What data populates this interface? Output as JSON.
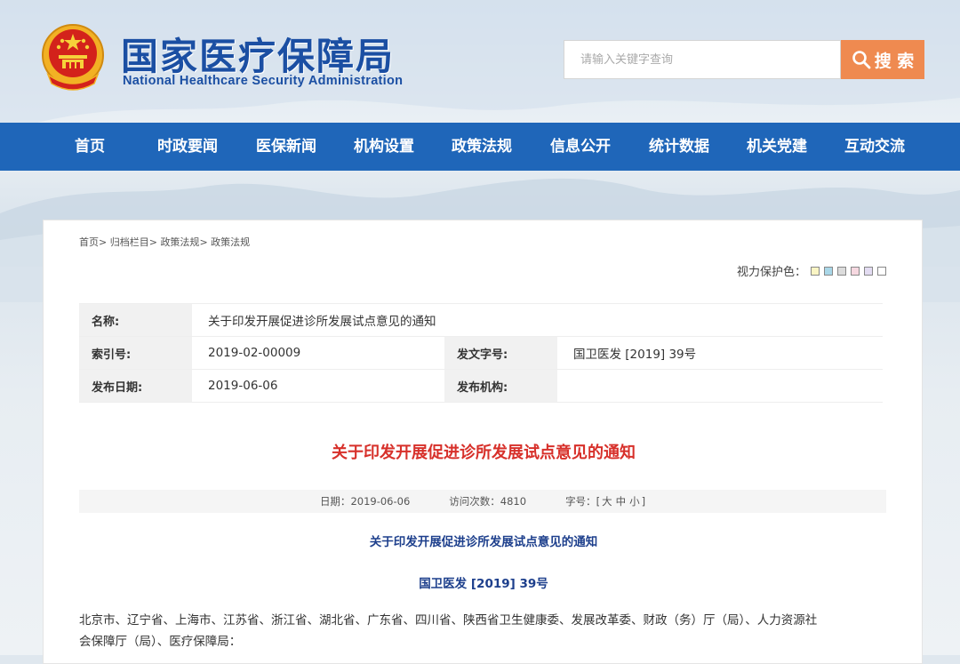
{
  "header": {
    "logo_cn": "国家医疗保障局",
    "logo_en": "National Healthcare Security Administration",
    "search_placeholder": "请输入关键字查询",
    "search_button": "搜 索"
  },
  "nav": {
    "items": [
      {
        "label": "首页"
      },
      {
        "label": "时政要闻"
      },
      {
        "label": "医保新闻"
      },
      {
        "label": "机构设置"
      },
      {
        "label": "政策法规"
      },
      {
        "label": "信息公开"
      },
      {
        "label": "统计数据"
      },
      {
        "label": "机关党建"
      },
      {
        "label": "互动交流"
      }
    ]
  },
  "breadcrumb": {
    "items": [
      "首页",
      "归档栏目",
      "政策法规",
      "政策法规"
    ],
    "separator": ">"
  },
  "eye_care": {
    "label": "视力保护色：",
    "colors": [
      "#faf5c4",
      "#a9d7e8",
      "#dcdcdc",
      "#f6d8e0",
      "#e3dcf2",
      "#ffffff"
    ]
  },
  "meta": {
    "name_label": "名称:",
    "name_value": "关于印发开展促进诊所发展试点意见的通知",
    "index_label": "索引号:",
    "index_value": "2019-02-00009",
    "docno_label": "发文字号:",
    "docno_value": "国卫医发 [2019] 39号",
    "date_label": "发布日期:",
    "date_value": "2019-06-06",
    "issuer_label": "发布机构:",
    "issuer_value": ""
  },
  "article": {
    "title": "关于印发开展促进诊所发展试点意见的通知",
    "info_date_label": "日期：",
    "info_date": "2019-06-06",
    "info_visits_label": "访问次数：",
    "info_visits": "4810",
    "info_font_label": "字号：",
    "font_open": "[",
    "font_large": "大",
    "font_medium": "中",
    "font_small": "小",
    "font_close": "]",
    "subtitle": "关于印发开展促进诊所发展试点意见的通知",
    "doc_number": "国卫医发 [2019] 39号",
    "body_line1": "北京市、辽宁省、上海市、江苏省、浙江省、湖北省、广东省、四川省、陕西省卫生健康委、发展改革委、财政（务）厅（局）、人力资源社",
    "body_line2": "会保障厅（局）、医疗保障局："
  }
}
